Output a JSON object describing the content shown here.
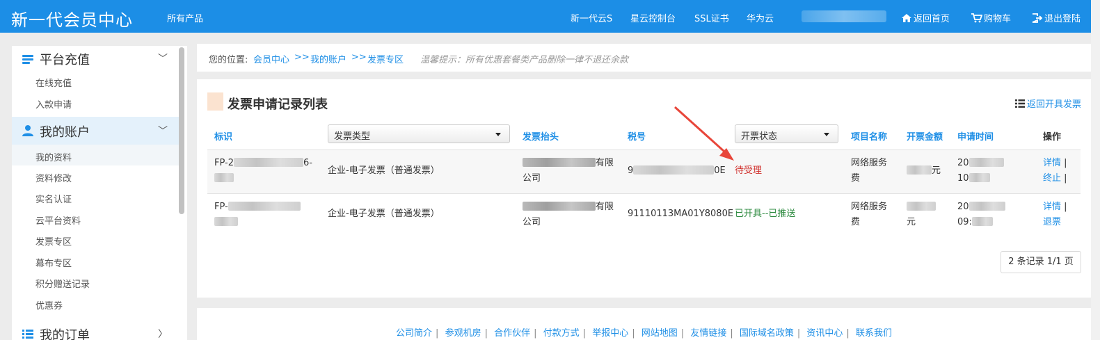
{
  "header": {
    "brand": "新一代会员中心",
    "all_products": "所有产品",
    "nav": [
      "新一代云S",
      "星云控制台",
      "SSL证书",
      "华为云"
    ],
    "home": "返回首页",
    "cart": "购物车",
    "logout": "退出登陆"
  },
  "sidebar": {
    "sections": [
      {
        "title": "平台充值",
        "items": [
          "在线充值",
          "入款申请"
        ]
      },
      {
        "title": "我的账户",
        "items": [
          "我的资料",
          "资料修改",
          "实名认证",
          "云平台资料",
          "发票专区",
          "幕布专区",
          "积分赠送记录",
          "优惠券"
        ]
      },
      {
        "title": "我的订单",
        "items": []
      }
    ]
  },
  "breadcrumb": {
    "prefix": "您的位置:",
    "path": [
      "会员中心",
      "我的账户",
      "发票专区"
    ],
    "sep": ">>",
    "hint": "温馨提示：所有优惠套餐类产品删除一律不退还余款"
  },
  "card": {
    "title": "发票申请记录列表",
    "return_link": "返回开具发票",
    "columns": {
      "id": "标识",
      "type_select": "发票类型",
      "header": "发票抬头",
      "tax_no": "税号",
      "status_select": "开票状态",
      "project": "项目名称",
      "amount": "开票金额",
      "apply_time": "申请时间",
      "action": "操作"
    },
    "rows": [
      {
        "id_prefix": "FP-2",
        "id_suffix": "6-",
        "type": "企业-电子发票（普通发票）",
        "header_tail": "有限",
        "header_line2": "公司",
        "tax_prefix": "9",
        "tax_suffix": "0E",
        "status": "待受理",
        "project_l1": "网络服务",
        "project_l2": "费",
        "amount_unit": "元",
        "time_l1": "20",
        "time_l2": "10",
        "action1": "详情",
        "action2": "终止"
      },
      {
        "id_prefix": "FP-",
        "type": "企业-电子发票（普通发票）",
        "header_tail": "有限",
        "header_line2": "公司",
        "tax_no": "91110113MA01Y8080E",
        "status": "已开具--已推送",
        "project_l1": "网络服务",
        "project_l2": "费",
        "amount_unit": "元",
        "time_l1": "20",
        "time_l2": "09:",
        "action1": "详情",
        "action2": "退票"
      }
    ],
    "pager": "2 条记录 1/1 页"
  },
  "footer": {
    "links": [
      "公司简介",
      "参观机房",
      "合作伙伴",
      "付款方式",
      "举报中心",
      "网站地图",
      "友情链接",
      "国际域名政策",
      "资讯中心",
      "联系我们"
    ]
  },
  "colors": {
    "header_bg": "#1c8ee6",
    "link": "#1f8fe6",
    "status_pending": "#d0312d",
    "status_done": "#2e8b40"
  }
}
